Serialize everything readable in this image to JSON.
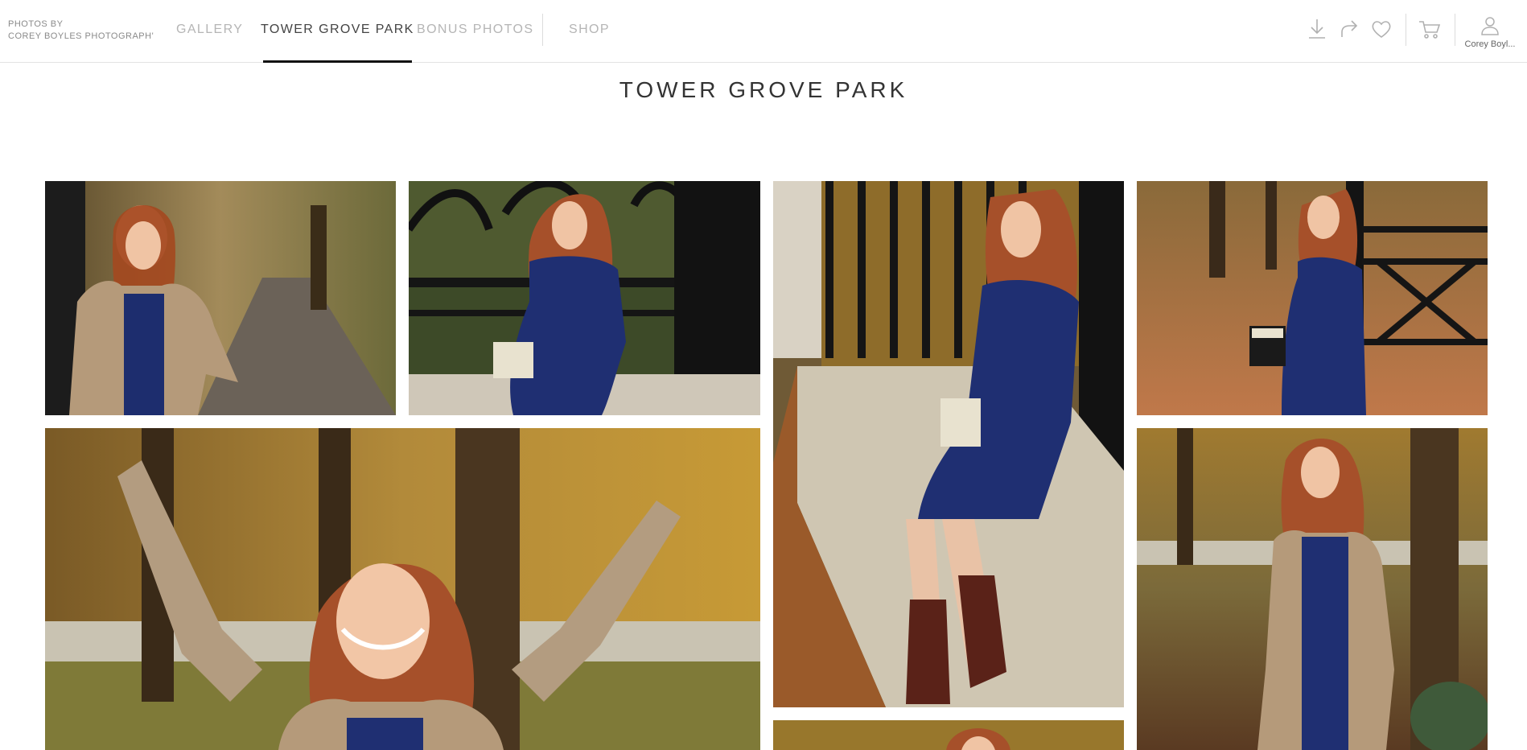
{
  "header": {
    "brand_line1": "PHOTOS BY",
    "brand_line2": "COREY BOYLES PHOTOGRAPH'",
    "tabs": [
      {
        "label": "GALLERY"
      },
      {
        "label": "TOWER GROVE PARK"
      },
      {
        "label": "BONUS PHOTOS"
      },
      {
        "label": "SHOP"
      }
    ],
    "active_tab": "TOWER GROVE PARK",
    "icons": [
      "download-icon",
      "share-icon",
      "heart-icon",
      "cart-icon",
      "user-icon"
    ],
    "account_name": "Corey Boyl..."
  },
  "main": {
    "title": "TOWER GROVE PARK"
  },
  "colors": {
    "accent": "#111111",
    "inactive_tab": "#b5b5b5",
    "active_tab": "#444444"
  }
}
